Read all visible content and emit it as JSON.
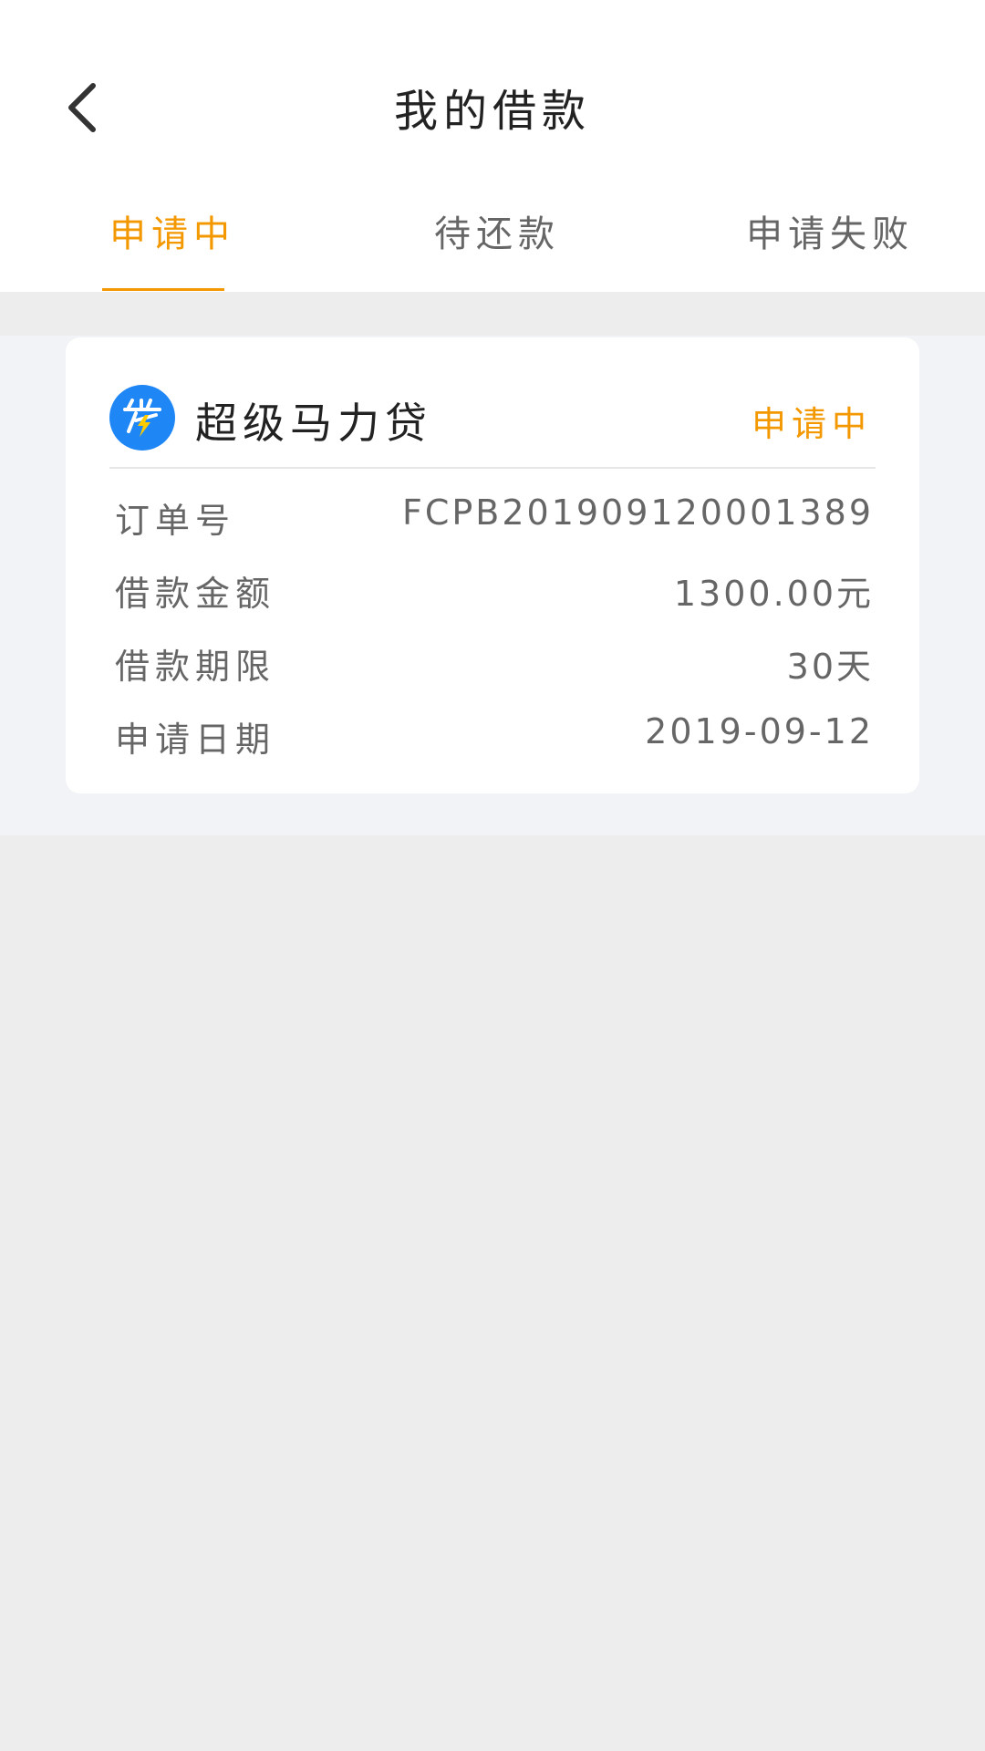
{
  "header": {
    "title": "我的借款"
  },
  "tabs": [
    {
      "label": "申请中",
      "active": true
    },
    {
      "label": "待还款",
      "active": false
    },
    {
      "label": "申请失败",
      "active": false
    }
  ],
  "colors": {
    "accent": "#f39800",
    "logo_bg": "#1f87f5"
  },
  "card": {
    "brand_name": "超级马力贷",
    "status": "申请中",
    "rows": [
      {
        "label": "订单号",
        "value": "FCPB201909120001389"
      },
      {
        "label": "借款金额",
        "value": "1300.00元"
      },
      {
        "label": "借款期限",
        "value": "30天"
      },
      {
        "label": "申请日期",
        "value": "2019-09-12"
      }
    ]
  },
  "icons": {
    "back": "chevron-left-icon",
    "logo": "loan-logo-icon"
  }
}
